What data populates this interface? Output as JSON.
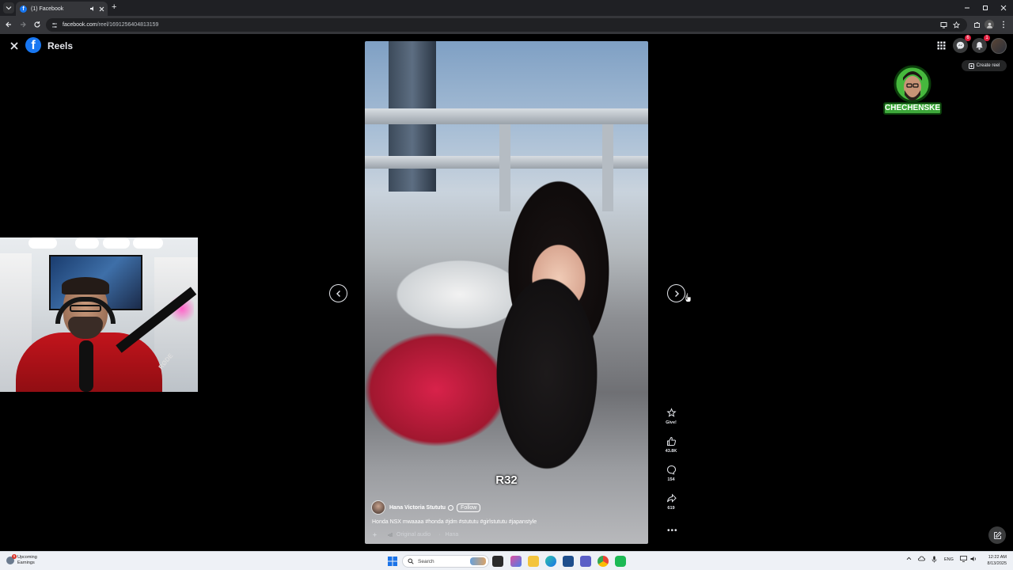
{
  "browser": {
    "tab_title": "(1) Facebook",
    "new_tab_symbol": "+",
    "url_host": "facebook.com",
    "url_path": "/reel/1691256404813159"
  },
  "header": {
    "title": "Reels",
    "messenger_badge": "6",
    "notifications_badge": "1",
    "create_reel_label": "Create reel"
  },
  "overlay": {
    "channel_name": "CHECHENSKE"
  },
  "reel": {
    "caption": "R32",
    "author_name": "Hana Victoria Stututu",
    "follow_label": "Follow",
    "description": "Honda NSX mwaaaa #honda #jdm #stututu #girlstututu #japanstyle",
    "audio_label": "Original audio",
    "audio_author": "Hana"
  },
  "actions": {
    "give_label": "Give!",
    "likes": "43.8K",
    "comments": "154",
    "shares": "619",
    "more_symbol": "•••"
  },
  "taskbar": {
    "weather_line1": "Upcoming",
    "weather_line2": "Earnings",
    "weather_badge": "6",
    "search_placeholder": "Search",
    "language": "ENG",
    "time": "12:22 AM",
    "date": "8/13/2025"
  },
  "colors": {
    "facebook_blue": "#1877f2",
    "page_background": "#000000",
    "badge_red": "#e41e3f"
  }
}
